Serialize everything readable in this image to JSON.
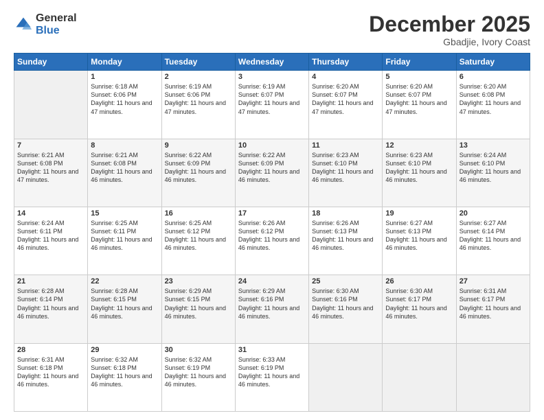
{
  "logo": {
    "general": "General",
    "blue": "Blue"
  },
  "header": {
    "month": "December 2025",
    "location": "Gbadjie, Ivory Coast"
  },
  "weekdays": [
    "Sunday",
    "Monday",
    "Tuesday",
    "Wednesday",
    "Thursday",
    "Friday",
    "Saturday"
  ],
  "weeks": [
    [
      {
        "day": "",
        "empty": true
      },
      {
        "day": "1",
        "sunrise": "6:18 AM",
        "sunset": "6:06 PM",
        "daylight": "11 hours and 47 minutes."
      },
      {
        "day": "2",
        "sunrise": "6:19 AM",
        "sunset": "6:06 PM",
        "daylight": "11 hours and 47 minutes."
      },
      {
        "day": "3",
        "sunrise": "6:19 AM",
        "sunset": "6:07 PM",
        "daylight": "11 hours and 47 minutes."
      },
      {
        "day": "4",
        "sunrise": "6:20 AM",
        "sunset": "6:07 PM",
        "daylight": "11 hours and 47 minutes."
      },
      {
        "day": "5",
        "sunrise": "6:20 AM",
        "sunset": "6:07 PM",
        "daylight": "11 hours and 47 minutes."
      },
      {
        "day": "6",
        "sunrise": "6:20 AM",
        "sunset": "6:08 PM",
        "daylight": "11 hours and 47 minutes."
      }
    ],
    [
      {
        "day": "7",
        "sunrise": "6:21 AM",
        "sunset": "6:08 PM",
        "daylight": "11 hours and 47 minutes."
      },
      {
        "day": "8",
        "sunrise": "6:21 AM",
        "sunset": "6:08 PM",
        "daylight": "11 hours and 46 minutes."
      },
      {
        "day": "9",
        "sunrise": "6:22 AM",
        "sunset": "6:09 PM",
        "daylight": "11 hours and 46 minutes."
      },
      {
        "day": "10",
        "sunrise": "6:22 AM",
        "sunset": "6:09 PM",
        "daylight": "11 hours and 46 minutes."
      },
      {
        "day": "11",
        "sunrise": "6:23 AM",
        "sunset": "6:10 PM",
        "daylight": "11 hours and 46 minutes."
      },
      {
        "day": "12",
        "sunrise": "6:23 AM",
        "sunset": "6:10 PM",
        "daylight": "11 hours and 46 minutes."
      },
      {
        "day": "13",
        "sunrise": "6:24 AM",
        "sunset": "6:10 PM",
        "daylight": "11 hours and 46 minutes."
      }
    ],
    [
      {
        "day": "14",
        "sunrise": "6:24 AM",
        "sunset": "6:11 PM",
        "daylight": "11 hours and 46 minutes."
      },
      {
        "day": "15",
        "sunrise": "6:25 AM",
        "sunset": "6:11 PM",
        "daylight": "11 hours and 46 minutes."
      },
      {
        "day": "16",
        "sunrise": "6:25 AM",
        "sunset": "6:12 PM",
        "daylight": "11 hours and 46 minutes."
      },
      {
        "day": "17",
        "sunrise": "6:26 AM",
        "sunset": "6:12 PM",
        "daylight": "11 hours and 46 minutes."
      },
      {
        "day": "18",
        "sunrise": "6:26 AM",
        "sunset": "6:13 PM",
        "daylight": "11 hours and 46 minutes."
      },
      {
        "day": "19",
        "sunrise": "6:27 AM",
        "sunset": "6:13 PM",
        "daylight": "11 hours and 46 minutes."
      },
      {
        "day": "20",
        "sunrise": "6:27 AM",
        "sunset": "6:14 PM",
        "daylight": "11 hours and 46 minutes."
      }
    ],
    [
      {
        "day": "21",
        "sunrise": "6:28 AM",
        "sunset": "6:14 PM",
        "daylight": "11 hours and 46 minutes."
      },
      {
        "day": "22",
        "sunrise": "6:28 AM",
        "sunset": "6:15 PM",
        "daylight": "11 hours and 46 minutes."
      },
      {
        "day": "23",
        "sunrise": "6:29 AM",
        "sunset": "6:15 PM",
        "daylight": "11 hours and 46 minutes."
      },
      {
        "day": "24",
        "sunrise": "6:29 AM",
        "sunset": "6:16 PM",
        "daylight": "11 hours and 46 minutes."
      },
      {
        "day": "25",
        "sunrise": "6:30 AM",
        "sunset": "6:16 PM",
        "daylight": "11 hours and 46 minutes."
      },
      {
        "day": "26",
        "sunrise": "6:30 AM",
        "sunset": "6:17 PM",
        "daylight": "11 hours and 46 minutes."
      },
      {
        "day": "27",
        "sunrise": "6:31 AM",
        "sunset": "6:17 PM",
        "daylight": "11 hours and 46 minutes."
      }
    ],
    [
      {
        "day": "28",
        "sunrise": "6:31 AM",
        "sunset": "6:18 PM",
        "daylight": "11 hours and 46 minutes."
      },
      {
        "day": "29",
        "sunrise": "6:32 AM",
        "sunset": "6:18 PM",
        "daylight": "11 hours and 46 minutes."
      },
      {
        "day": "30",
        "sunrise": "6:32 AM",
        "sunset": "6:19 PM",
        "daylight": "11 hours and 46 minutes."
      },
      {
        "day": "31",
        "sunrise": "6:33 AM",
        "sunset": "6:19 PM",
        "daylight": "11 hours and 46 minutes."
      },
      {
        "day": "",
        "empty": true
      },
      {
        "day": "",
        "empty": true
      },
      {
        "day": "",
        "empty": true
      }
    ]
  ]
}
